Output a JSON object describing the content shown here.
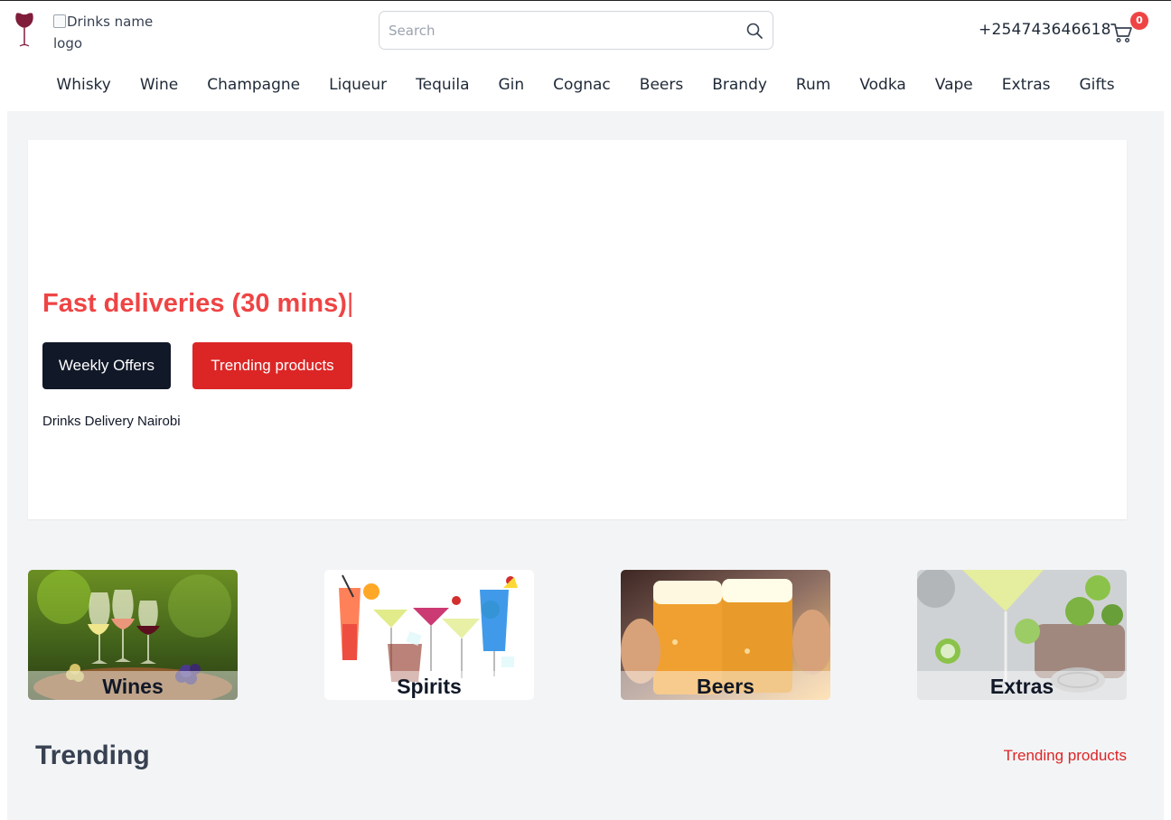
{
  "header": {
    "logo_alt": "Drinks name logo",
    "search_placeholder": "Search",
    "phone": "+254743646618",
    "cart_count": "0"
  },
  "nav": {
    "items": [
      "Whisky",
      "Wine",
      "Champagne",
      "Liqueur",
      "Tequila",
      "Gin",
      "Cognac",
      "Beers",
      "Brandy",
      "Rum",
      "Vodka",
      "Vape",
      "Extras",
      "Gifts"
    ]
  },
  "hero": {
    "title": "Fast deliveries (30 mins)",
    "cursor": "|",
    "weekly_offers_label": "Weekly Offers",
    "trending_products_label": "Trending products",
    "subtitle": "Drinks Delivery Nairobi"
  },
  "categories": [
    {
      "label": "Wines"
    },
    {
      "label": "Spirits"
    },
    {
      "label": "Beers"
    },
    {
      "label": "Extras"
    }
  ],
  "trending": {
    "title": "Trending",
    "link_label": "Trending products"
  },
  "colors": {
    "accent_red": "#dc2626",
    "hero_title_red": "#ef4444",
    "dark_button": "#111827",
    "page_bg": "#f3f4f6"
  }
}
